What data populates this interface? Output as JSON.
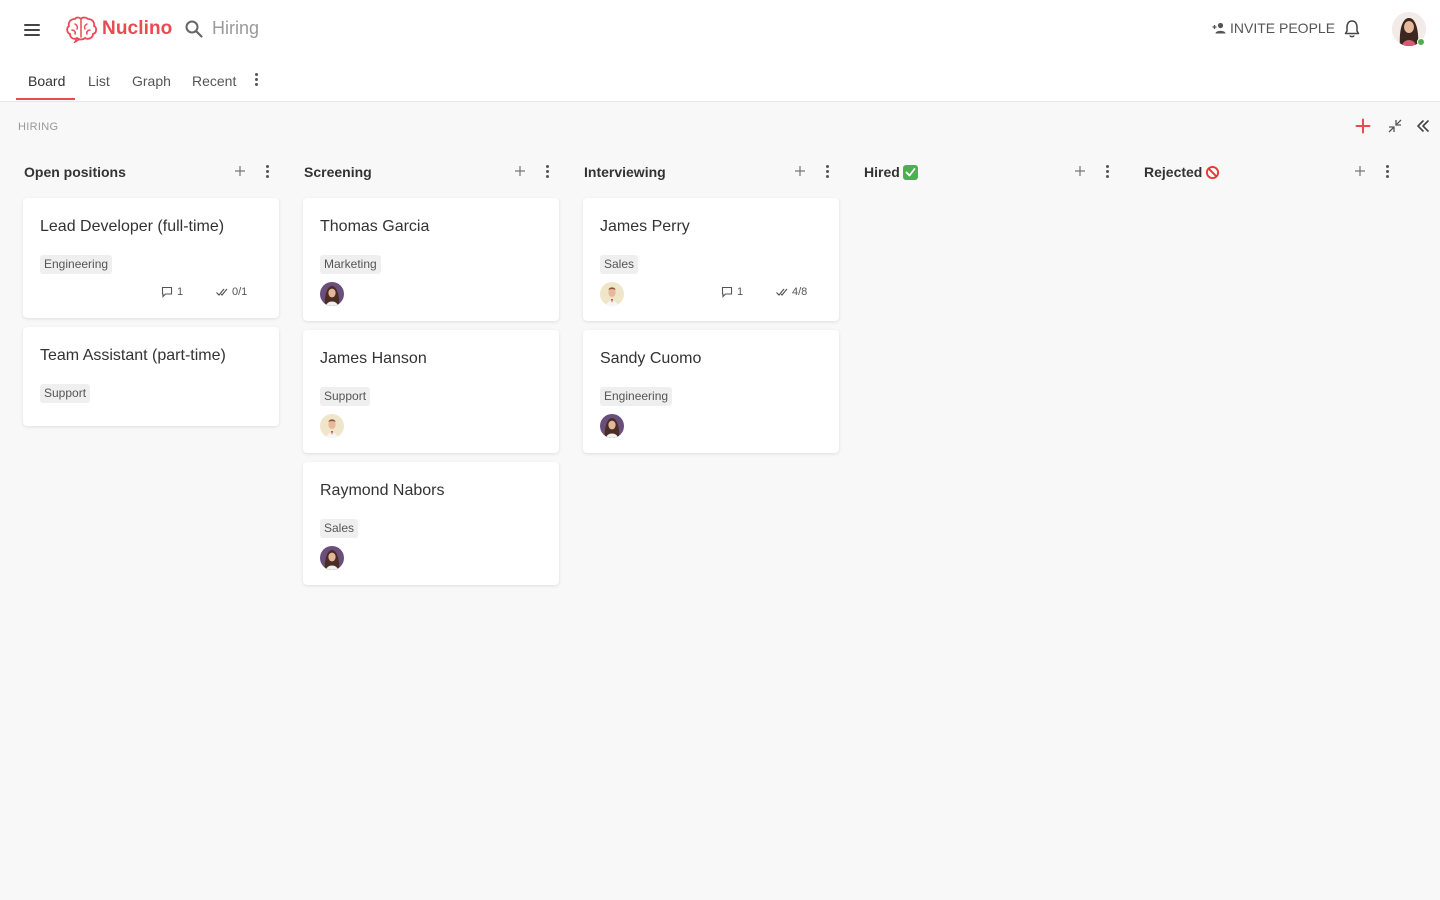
{
  "app": {
    "logo_text": "Nuclino",
    "search_placeholder": "Hiring",
    "invite_label": "INVITE PEOPLE",
    "accent_color": "#e94a54",
    "online_color": "#4caf50"
  },
  "tabs": [
    {
      "label": "Board",
      "active": true
    },
    {
      "label": "List",
      "active": false
    },
    {
      "label": "Graph",
      "active": false
    },
    {
      "label": "Recent",
      "active": false
    }
  ],
  "board": {
    "section_label": "HIRING",
    "columns": [
      {
        "title": "Open positions",
        "emoji": "",
        "cards": [
          {
            "title": "Lead Developer (full-time)",
            "tag": "Engineering",
            "avatar": "",
            "comments": "1",
            "tasks": "0/1"
          },
          {
            "title": "Team Assistant (part-time)",
            "tag": "Support",
            "avatar": "",
            "comments": "",
            "tasks": ""
          }
        ]
      },
      {
        "title": "Screening",
        "emoji": "",
        "cards": [
          {
            "title": "Thomas Garcia",
            "tag": "Marketing",
            "avatar": "woman-avatar",
            "comments": "",
            "tasks": ""
          },
          {
            "title": "James Hanson",
            "tag": "Support",
            "avatar": "man-avatar",
            "comments": "",
            "tasks": ""
          },
          {
            "title": "Raymond Nabors",
            "tag": "Sales",
            "avatar": "woman-avatar",
            "comments": "",
            "tasks": ""
          }
        ]
      },
      {
        "title": "Interviewing",
        "emoji": "",
        "cards": [
          {
            "title": "James Perry",
            "tag": "Sales",
            "avatar": "man-avatar",
            "comments": "1",
            "tasks": "4/8"
          },
          {
            "title": "Sandy Cuomo",
            "tag": "Engineering",
            "avatar": "woman-avatar",
            "comments": "",
            "tasks": ""
          }
        ]
      },
      {
        "title": "Hired",
        "emoji": "check-mark-emoji",
        "cards": []
      },
      {
        "title": "Rejected",
        "emoji": "no-entry-emoji",
        "cards": []
      }
    ]
  }
}
